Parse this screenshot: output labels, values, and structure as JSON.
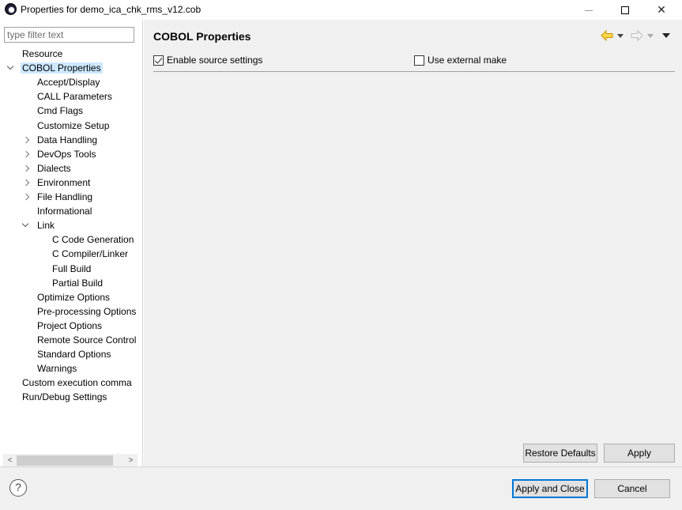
{
  "window": {
    "title": "Properties for demo_ica_chk_rms_v12.cob",
    "minimize_label": "",
    "maximize_label": "",
    "close_label": "✕"
  },
  "filter": {
    "placeholder": "type filter text",
    "value": ""
  },
  "tree": [
    {
      "label": "Resource",
      "level": 0,
      "twisty": "none"
    },
    {
      "label": "COBOL Properties",
      "level": 0,
      "twisty": "open",
      "selected": true
    },
    {
      "label": "Accept/Display",
      "level": 1,
      "twisty": "none"
    },
    {
      "label": "CALL Parameters",
      "level": 1,
      "twisty": "none"
    },
    {
      "label": "Cmd Flags",
      "level": 1,
      "twisty": "none"
    },
    {
      "label": "Customize Setup",
      "level": 1,
      "twisty": "none"
    },
    {
      "label": "Data Handling",
      "level": 1,
      "twisty": "closed"
    },
    {
      "label": "DevOps Tools",
      "level": 1,
      "twisty": "closed"
    },
    {
      "label": "Dialects",
      "level": 1,
      "twisty": "closed"
    },
    {
      "label": "Environment",
      "level": 1,
      "twisty": "closed"
    },
    {
      "label": "File Handling",
      "level": 1,
      "twisty": "closed"
    },
    {
      "label": "Informational",
      "level": 1,
      "twisty": "none"
    },
    {
      "label": "Link",
      "level": 1,
      "twisty": "open"
    },
    {
      "label": "C Code Generation",
      "level": 2,
      "twisty": "none"
    },
    {
      "label": "C Compiler/Linker",
      "level": 2,
      "twisty": "none"
    },
    {
      "label": "Full Build",
      "level": 2,
      "twisty": "none"
    },
    {
      "label": "Partial Build",
      "level": 2,
      "twisty": "none"
    },
    {
      "label": "Optimize Options",
      "level": 1,
      "twisty": "none"
    },
    {
      "label": "Pre-processing Options",
      "level": 1,
      "twisty": "none"
    },
    {
      "label": "Project Options",
      "level": 1,
      "twisty": "none"
    },
    {
      "label": "Remote Source Control",
      "level": 1,
      "twisty": "none"
    },
    {
      "label": "Standard Options",
      "level": 1,
      "twisty": "none"
    },
    {
      "label": "Warnings",
      "level": 1,
      "twisty": "none"
    },
    {
      "label": "Custom execution comma",
      "level": 0,
      "twisty": "none"
    },
    {
      "label": "Run/Debug Settings",
      "level": 0,
      "twisty": "none"
    }
  ],
  "scrollbar": {
    "left_arrow": "<",
    "right_arrow": ">"
  },
  "page": {
    "title": "COBOL Properties",
    "enable_source_settings": {
      "label": "Enable source settings",
      "checked": true
    },
    "use_external_make": {
      "label": "Use external make",
      "checked": false
    },
    "restore_defaults": "Restore Defaults",
    "apply": "Apply"
  },
  "footer": {
    "help": "?",
    "apply_and_close": "Apply and Close",
    "cancel": "Cancel"
  },
  "colors": {
    "selection": "#cce8ff",
    "nav_back": "#e8b400",
    "nav_fwd": "#c8c8c8",
    "default_button_border": "#0078d7"
  }
}
